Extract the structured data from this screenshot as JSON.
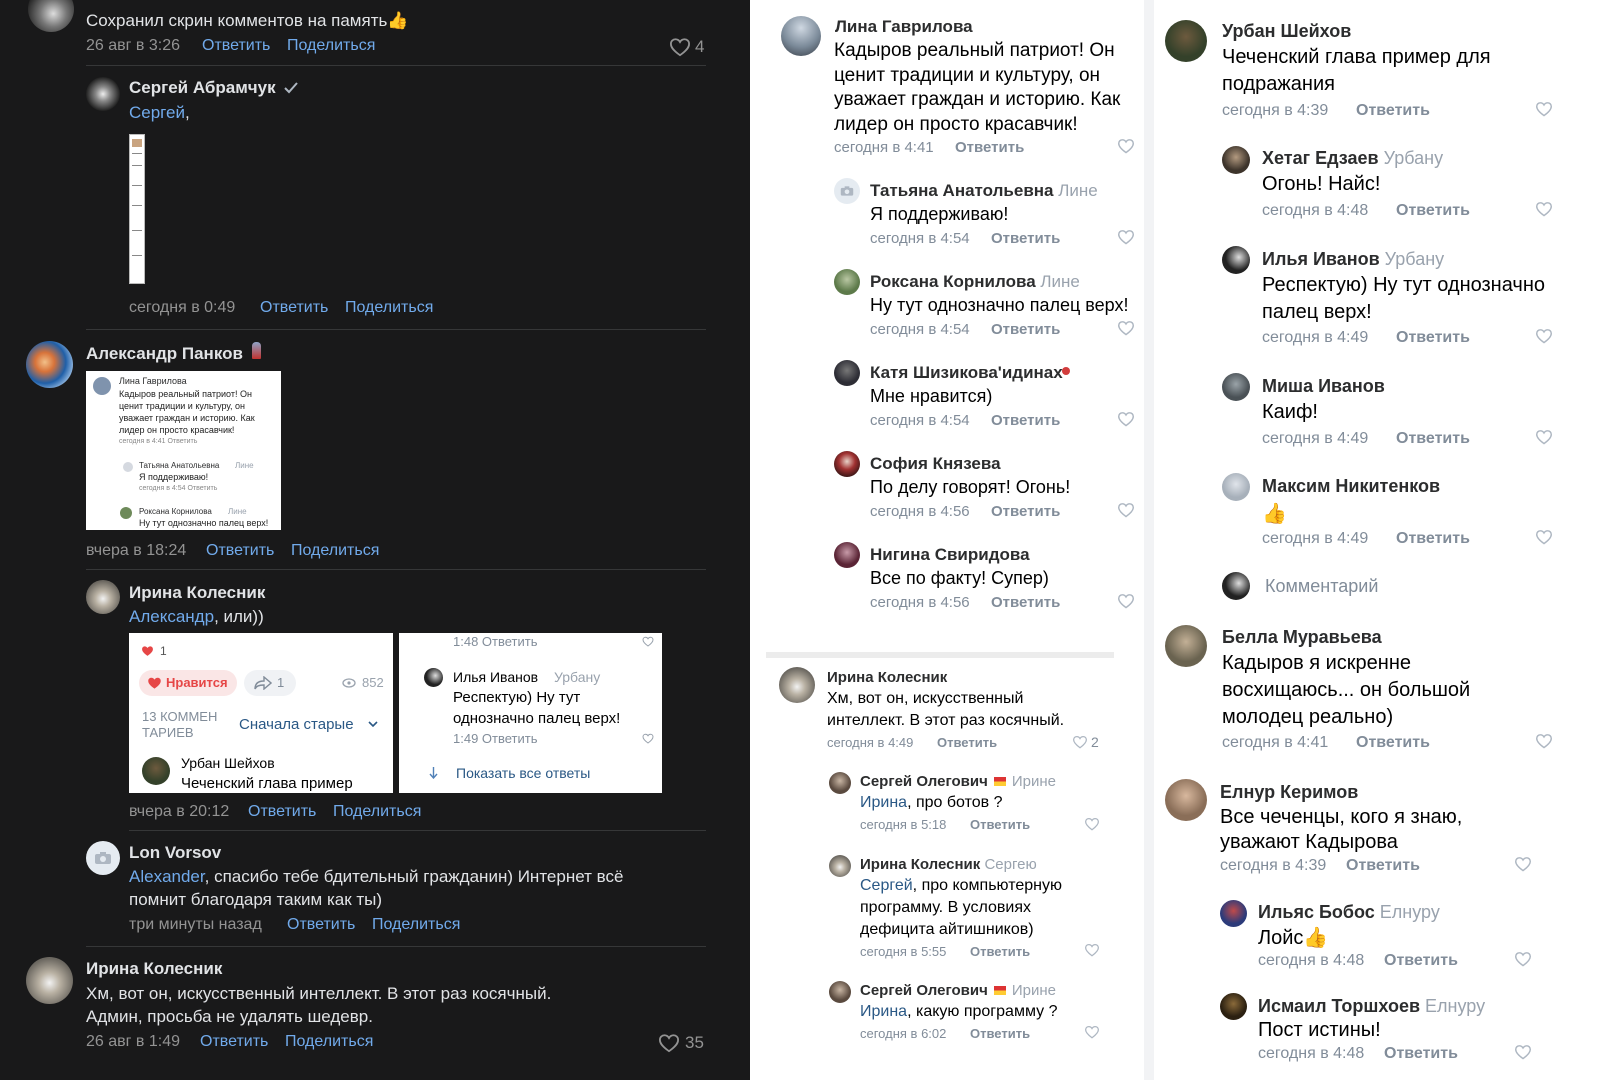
{
  "left": {
    "c1": {
      "text": "Сохранил скрин комментов на память👍",
      "time": "26 авг в 3:26",
      "reply": "Ответить",
      "share": "Поделиться",
      "likes": "4"
    },
    "c2": {
      "name": "Сергей Абрамчук",
      "mention": "Сергей",
      "after": ",",
      "time": "сегодня в 0:49",
      "reply": "Ответить",
      "share": "Поделиться"
    },
    "c3": {
      "name": "Александр Панков",
      "time": "вчера в 18:24",
      "reply": "Ответить",
      "share": "Поделиться",
      "thumb": {
        "n1": "Лина Гаврилова",
        "l1": "Кадыров реальный патриот! Он",
        "l2": "ценит традиции и культуру, он",
        "l3": "уважает граждан и историю. Как",
        "l4": "лидер он просто красавчик!",
        "m1": "сегодня в 4:41   Ответить",
        "n2": "Татьяна Анатольевна",
        "r2": "Лине",
        "l5": "Я поддерживаю!",
        "m2": "сегодня в 4:54   Ответить",
        "n3": "Роксана Корнилова",
        "r3": "Лине",
        "l6": "Ну тут однозначно палец верх!"
      }
    },
    "c4": {
      "name": "Ирина Колесник",
      "mention": "Александр",
      "after": ", или))",
      "time": "вчера в 20:12",
      "reply": "Ответить",
      "share": "Поделиться",
      "thumbA": {
        "count": "1",
        "like": "Нравится",
        "shares": "1",
        "views": "852",
        "comments1": "13 КОММЕН",
        "comments2": "ТАРИЕВ",
        "sort": "Сначала старые",
        "name": "Урбан Шейхов",
        "text": "Чеченский глава пример"
      },
      "thumbB": {
        "m1": "1:48   Ответить",
        "name": "Илья Иванов",
        "reply": "Урбану",
        "l1": "Респектую) Ну тут",
        "l2": "однозначно палец верх!",
        "m2": "1:49   Ответить",
        "show": "Показать все ответы"
      }
    },
    "c5": {
      "name": "Lon Vorsov",
      "mention": "Alexander",
      "line1": ", спасибо тебе бдительный гражданин) Интернет всё",
      "line2": "помнит благодаря таким как ты)",
      "time": "три минуты назад",
      "reply": "Ответить",
      "share": "Поделиться"
    },
    "c6": {
      "name": "Ирина Колесник",
      "line1": "Хм, вот он, искусственный интеллект. В этот раз косячный.",
      "line2": "Админ, просьба не удалять шедевр.",
      "time": "26 авг в 1:49",
      "reply": "Ответить",
      "share": "Поделиться",
      "likes": "35"
    }
  },
  "mid": {
    "c1": {
      "name": "Лина Гаврилова",
      "l1": "Кадыров реальный патриот! Он",
      "l2": "ценит традиции и культуру, он",
      "l3": "уважает граждан и историю. Как",
      "l4": "лидер он просто красавчик!",
      "time": "сегодня в 4:41",
      "reply": "Ответить"
    },
    "r1": {
      "name": "Татьяна Анатольевна",
      "to": "Лине",
      "text": "Я поддерживаю!",
      "time": "сегодня в 4:54",
      "reply": "Ответить"
    },
    "r2": {
      "name": "Роксана Корнилова",
      "to": "Лине",
      "text": "Ну тут однозначно палец верх!",
      "time": "сегодня в 4:54",
      "reply": "Ответить"
    },
    "r3": {
      "name": "Катя Шизикова'идинах",
      "text": "Мне нравится)",
      "time": "сегодня в 4:54",
      "reply": "Ответить"
    },
    "r4": {
      "name": "София Князева",
      "text": "По делу говорят! Огонь!",
      "time": "сегодня в 4:56",
      "reply": "Ответить"
    },
    "r5": {
      "name": "Нигина Свиридова",
      "text": "Все по факту! Супер)",
      "time": "сегодня в 4:56",
      "reply": "Ответить"
    },
    "c2": {
      "name": "Ирина Колесник",
      "l1": "Хм, вот он, искусственный",
      "l2": "интеллект. В этот раз косячный.",
      "time": "сегодня в 4:49",
      "reply": "Ответить",
      "likes": "2"
    },
    "s1": {
      "name": "Сергей Олегович",
      "to": "Ирине",
      "mention": "Ирина",
      "text": ", про ботов ?",
      "time": "сегодня в 5:18",
      "reply": "Ответить"
    },
    "s2": {
      "name": "Ирина Колесник",
      "to": "Сергею",
      "mention": "Сергей",
      "l1": ", про компьютерную",
      "l2": "программу. В условиях",
      "l3": "дефицита айтишников)",
      "time": "сегодня в 5:55",
      "reply": "Ответить"
    },
    "s3": {
      "name": "Сергей Олегович",
      "to": "Ирине",
      "mention": "Ирина",
      "text": ", какую программу ?",
      "time": "сегодня в 6:02",
      "reply": "Ответить"
    }
  },
  "right": {
    "c1": {
      "name": "Урбан Шейхов",
      "l1": "Чеченский глава пример для",
      "l2": "подражания",
      "time": "сегодня в 4:39",
      "reply": "Ответить"
    },
    "r1": {
      "name": "Хетаг Едзаев",
      "to": "Урбану",
      "text": "Огонь!  Найс!",
      "time": "сегодня в 4:48",
      "reply": "Ответить"
    },
    "r2": {
      "name": "Илья Иванов",
      "to": "Урбану",
      "l1": "Респектую) Ну тут однозначно",
      "l2": "палец верх!",
      "time": "сегодня в 4:49",
      "reply": "Ответить"
    },
    "r3": {
      "name": "Миша Иванов",
      "text": "Каиф!",
      "time": "сегодня в 4:49",
      "reply": "Ответить"
    },
    "r4": {
      "name": "Максим Никитенков",
      "text": "👍",
      "time": "сегодня в 4:49",
      "reply": "Ответить"
    },
    "composer": {
      "placeholder": "Комментарий"
    },
    "c2": {
      "name": "Белла Муравьева",
      "l1": "Кадыров я искренне",
      "l2": "восхищаюсь... он большой",
      "l3": "молодец реально)",
      "time": "сегодня в 4:41",
      "reply": "Ответить"
    },
    "c3": {
      "name": "Елнур Керимов",
      "l1": "Все чеченцы, кого я знаю,",
      "l2": "уважают Кадырова",
      "time": "сегодня в 4:39",
      "reply": "Ответить"
    },
    "r5": {
      "name": "Ильяс Бобос",
      "to": "Елнуру",
      "text": "Лойс👍",
      "time": "сегодня в 4:48",
      "reply": "Ответить"
    },
    "r6": {
      "name": "Исмаил Торшхоев",
      "to": "Елнуру",
      "text": "Пост истины!",
      "time": "сегодня в 4:48",
      "reply": "Ответить"
    }
  }
}
